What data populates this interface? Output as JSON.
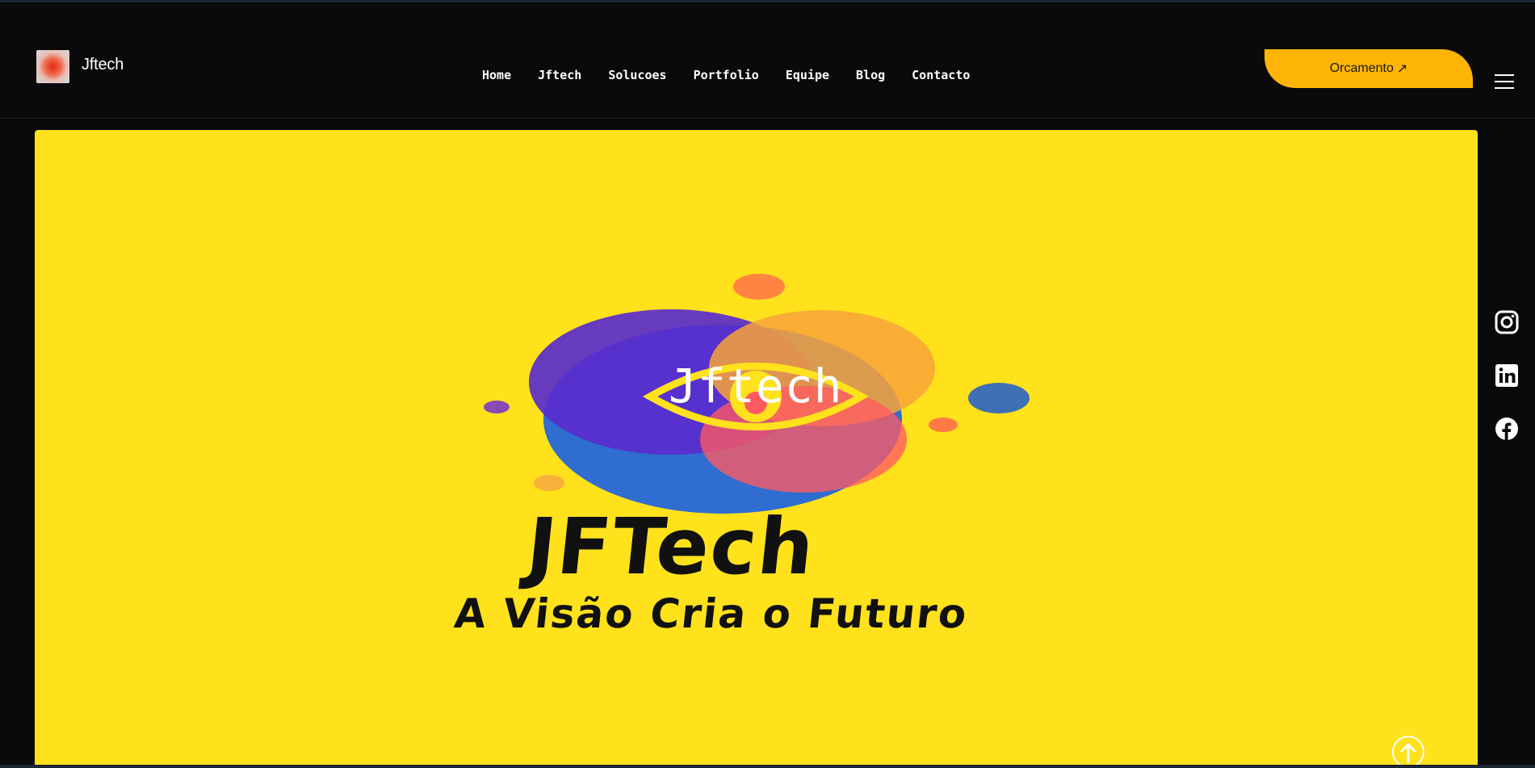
{
  "header": {
    "brand": "Jftech",
    "nav": [
      "Home",
      "Jftech",
      "Solucoes",
      "Portfolio",
      "Equipe",
      "Blog",
      "Contacto"
    ],
    "cta_label": "Orcamento",
    "cta_arrow": "↗",
    "cta_color": "#fdb404",
    "menu_icon": "hamburger-icon"
  },
  "hero": {
    "background_color": "#ffe11c",
    "overlay_text": "Jftech",
    "logo_title": "JFTech",
    "logo_tagline": "A Visão Cria o Futuro"
  },
  "social": {
    "icons": [
      "instagram-icon",
      "linkedin-icon",
      "facebook-icon"
    ]
  },
  "scroll_top_icon": "arrow-up-icon"
}
